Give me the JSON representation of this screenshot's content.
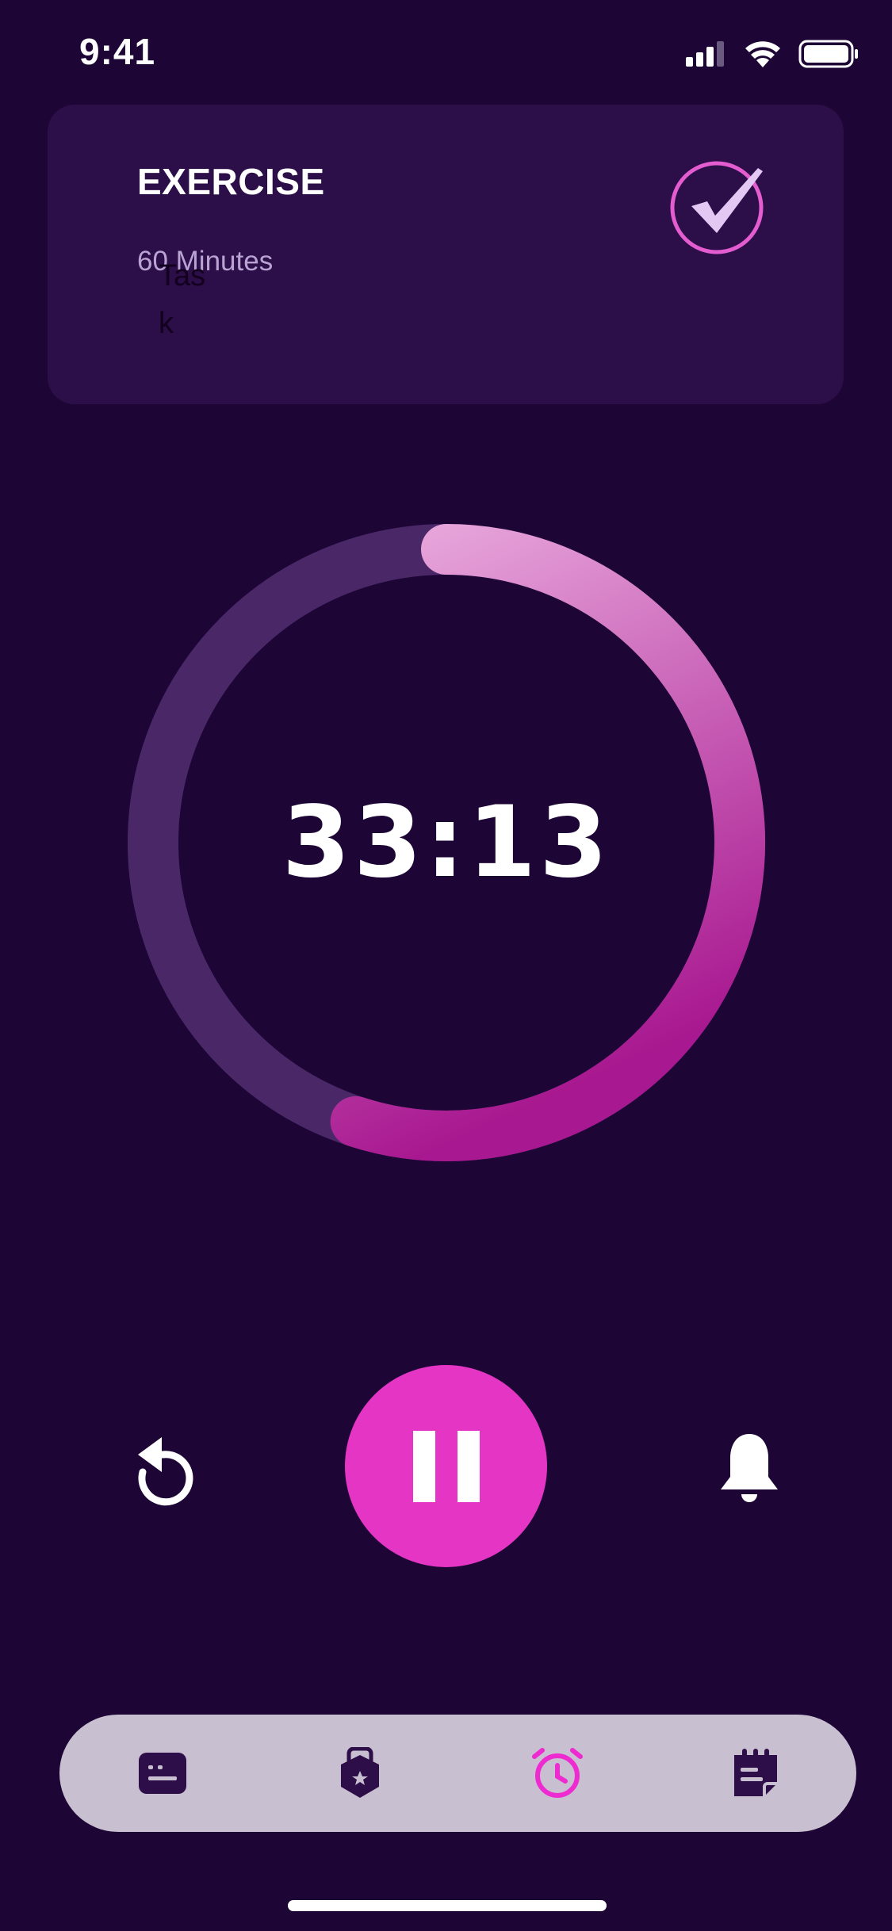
{
  "status_bar": {
    "time": "9:41"
  },
  "task_card": {
    "title": "EXERCISE",
    "duration": "60 Minutes",
    "overlay_label": "Task",
    "check_icon": "check-circle-icon"
  },
  "timer": {
    "display": "33:13",
    "progress": 0.55,
    "colors": {
      "track": "#4a2868",
      "start": "#e8a8dc",
      "end": "#a81890"
    }
  },
  "controls": {
    "reset_icon": "reset-icon",
    "pause_icon": "pause-icon",
    "bell_icon": "bell-icon",
    "accent": "#e535c5"
  },
  "tab_bar": {
    "items": [
      {
        "icon": "task-list-icon",
        "active": false
      },
      {
        "icon": "badge-icon",
        "active": false
      },
      {
        "icon": "alarm-clock-icon",
        "active": true
      },
      {
        "icon": "notes-icon",
        "active": false
      }
    ],
    "active_color": "#ee2bd0",
    "inactive_color": "#2d0e48"
  }
}
